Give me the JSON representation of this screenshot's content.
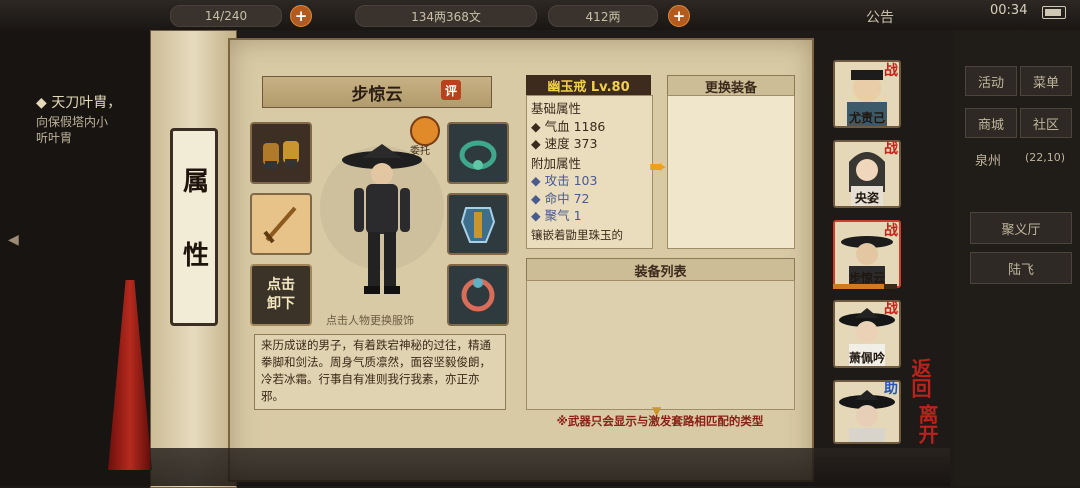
{
  "topbar": {
    "tower_count": "14/240",
    "money": "134两368文",
    "silver": "412两",
    "announce": "公告",
    "clock": "00:34"
  },
  "quest": {
    "title": "天刀叶胄，",
    "line1": "向保假塔内小",
    "line2": "听叶胄"
  },
  "scroll_title": [
    "属",
    "性"
  ],
  "character": {
    "name": "步惊云",
    "rate_label": "评",
    "entrust_label": "委托",
    "unequip_line1": "点击",
    "unequip_line2": "卸下",
    "change_outfit_hint": "点击人物更换服饰",
    "description": "来历成谜的男子，有着跌宕神秘的过往，精通拳脚和剑法。周身气质凛然，面容坚毅俊朗，冷若冰霜。行事自有准则我行我素，亦正亦邪。"
  },
  "item": {
    "name": "幽玉戒 Lv.80",
    "base_title": "基础属性",
    "base_stats": [
      "气血  1186",
      "速度  373"
    ],
    "extra_title": "附加属性",
    "extra_stats": [
      "攻击  103",
      "命中  72",
      "聚气  1"
    ],
    "socket_text": "镶嵌着勖里珠玉的"
  },
  "change_equip_label": "更换装备",
  "equip_list_label": "装备列表",
  "note": "※武器只会显示与激发套路相匹配的类型",
  "party": [
    {
      "name": "尤责己",
      "tag": "战"
    },
    {
      "name": "央姿",
      "tag": "战"
    },
    {
      "name": "步惊云",
      "tag": "战"
    },
    {
      "name": "萧佩吟",
      "tag": "战"
    },
    {
      "name": "",
      "tag": "助"
    }
  ],
  "right_menu": {
    "activity": "活动",
    "menu": "菜单",
    "shop": "商城",
    "community": "社区",
    "location": "泉州",
    "coords": "(22,10)",
    "hall": "聚义厅",
    "npc": "陆飞"
  },
  "return_label": "返回",
  "leave_label": "离开",
  "colors": {
    "accent_red": "#b9231b",
    "gold": "#f2d04a",
    "paper": "#d7caa5"
  }
}
